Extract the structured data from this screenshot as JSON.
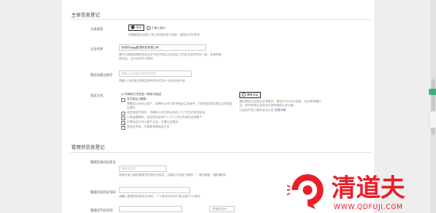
{
  "section1": {
    "title": "主体信息登记"
  },
  "subject_type": {
    "label": "主体类型",
    "selected": "企业",
    "option2": "个体工商户",
    "hint": "请根据营业执照上的主体类型进行选择，选择后不可修改"
  },
  "company_name": {
    "label": "企业名称",
    "value": "深圳市qqgg影视科技有限公司",
    "hint1": "需与当地政府颁发的商业许可证书或企业注册证上的企业名称完全一致，信息审核",
    "hint2": "成功后，企业名称不可修改"
  },
  "credit_code": {
    "label": "营业执照注册号",
    "placeholder": "请输入15位营业执照注册号",
    "hint": "请输入15位营业执照注册号或18位统一社会信用代码"
  },
  "verify": {
    "label": "验证方式",
    "header": "以下两种方式任选一种进行验证",
    "option1": "支付验证 (推荐)",
    "line1": "需要用公司对公账户，向腾讯公司打款来验证主体身份，打款信息将在提交主体信息",
    "line2": "后提供",
    "line3": "若在规定时间内，向腾讯公司打款后将在1个工作日内完成验证",
    "line4": "打款金额随机，验证成功后将于1-3个工作日内退还至原账户",
    "line5": "打款验证与对公账户认证，无需认证费用",
    "line6": "若验证失败，可重新选择验证方式",
    "highlight_btn": "微信认证",
    "note1": "通过微信认证验证主体身份，需支付300元认证费。认证审核通过",
    "note2": "后，即可获得认证标识并享有微信认证功能。",
    "note3": "认证后可在小程序后台认证",
    "note_link": "查看详情"
  },
  "section2": {
    "title": "管理员信息登记"
  },
  "admin_id": {
    "label": "管理员身份证姓名",
    "placeholder": "请填写姓名",
    "hint": "请填写该小程序管理员的身份证姓名，如果名字包含分隔号“·”，请勿省略",
    "hint_tail": "（如何填写）"
  },
  "admin_idnum": {
    "label": "管理员身份证号码",
    "hint": "请输入管理员的身份证号码，一个身份证号码只能注册5个小程序"
  },
  "admin_phone": {
    "label": "管理员手机号码",
    "button": "获取验证码"
  },
  "brand": {
    "name": "清道夫",
    "url": "WWW.QDFUJI.COM",
    "color": "#e8202a"
  }
}
